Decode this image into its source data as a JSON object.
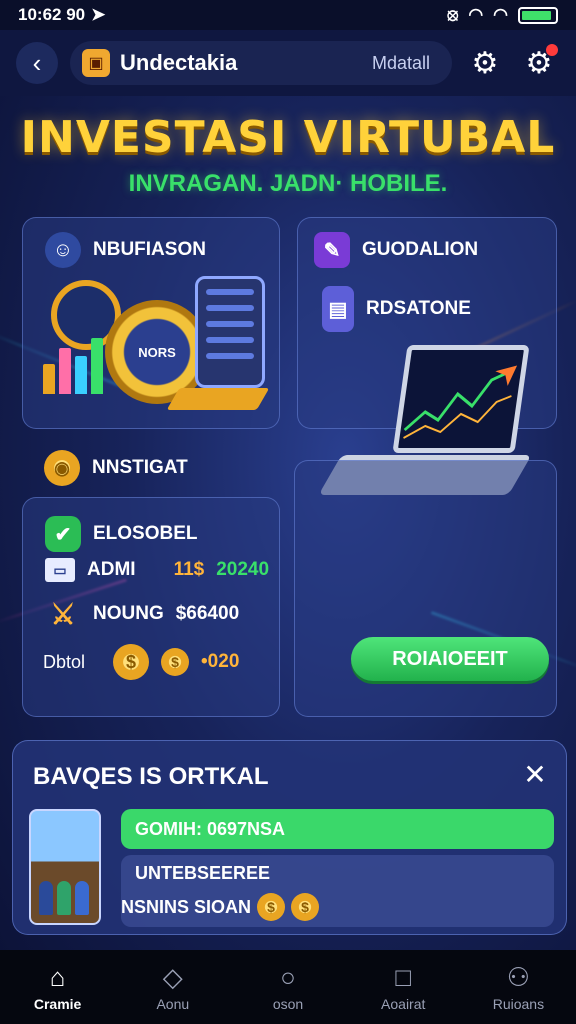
{
  "status_bar": {
    "time": "10:62 90",
    "battery_level": 0.9
  },
  "header": {
    "app_name": "Undectakia",
    "tag": "Mdatall"
  },
  "hero": {
    "title": "INVESTASI VIRTUBAL",
    "subtitle": "INVRAGAN. JADN· HOBILE."
  },
  "card_a": {
    "label": "NBUFIASON",
    "coin_text": "NORS"
  },
  "card_b": {
    "label1": "GUODALION",
    "label2": "RDSATONE"
  },
  "card_c": {
    "heading": "NNSTIGAT",
    "row1_label": "ELOSOBEL",
    "row2_label": "ADMI",
    "row2_value1": "11$",
    "row2_value2": "20240",
    "row3_label": "NOUNG",
    "row3_value": "$66400",
    "row4_label": "Dbtol",
    "row4_value": "•020"
  },
  "action_button": {
    "label": "ROIAIOEEIT"
  },
  "panel": {
    "title": "BAVQES IS ORTKAL",
    "close": "✕",
    "green_bar": "GOMIH: 0697NSA",
    "line1": "UNTEBSEEREE",
    "line2": "NSNINS SIOAN"
  },
  "bottom_nav": [
    {
      "label": "Cramie",
      "icon": "home-icon"
    },
    {
      "label": "Aonu",
      "icon": "diamond-icon"
    },
    {
      "label": "oson",
      "icon": "circle-icon"
    },
    {
      "label": "Aoairat",
      "icon": "square-icon"
    },
    {
      "label": "Ruioans",
      "icon": "user-icon"
    }
  ],
  "colors": {
    "accent_gold": "#ffd23a",
    "accent_green": "#39e06a",
    "background": "#17235a"
  }
}
